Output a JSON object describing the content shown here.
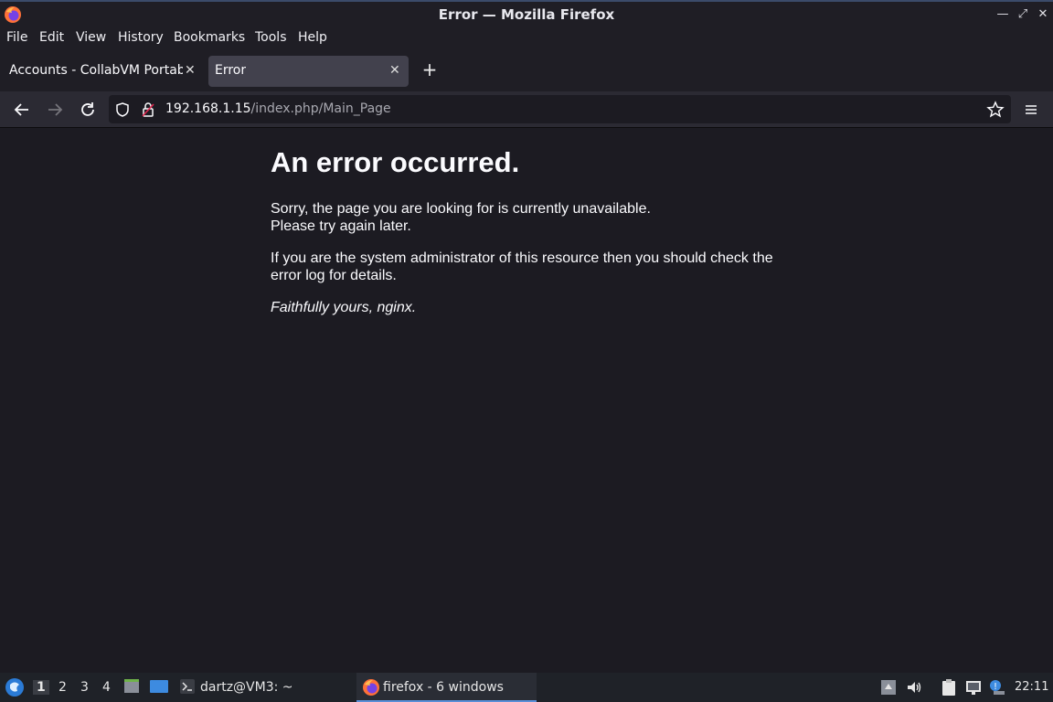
{
  "window": {
    "title": "Error — Mozilla Firefox"
  },
  "menu": [
    "File",
    "Edit",
    "View",
    "History",
    "Bookmarks",
    "Tools",
    "Help"
  ],
  "tabs": [
    {
      "label": "Accounts - CollabVM Portable",
      "active": false
    },
    {
      "label": "Error",
      "active": true
    }
  ],
  "urlbar": {
    "host": "192.168.1.15",
    "path": "/index.php/Main_Page"
  },
  "page": {
    "heading": "An error occurred.",
    "line1": "Sorry, the page you are looking for is currently unavailable.",
    "line2": "Please try again later.",
    "admin_line1": "If you are the system administrator of this resource then you should check the",
    "admin_line2": "error log for details.",
    "signature": "Faithfully yours, nginx."
  },
  "taskbar": {
    "workspaces": [
      "1",
      "2",
      "3",
      "4"
    ],
    "terminal_task": "dartz@VM3: ~",
    "firefox_task": "firefox - 6 windows",
    "clock": "22:11"
  },
  "colors": {
    "accent": "#5a8fd8",
    "background": "#1c1b22"
  },
  "icons": [
    "firefox-icon",
    "minimize-icon",
    "maximize-icon",
    "close-icon",
    "back-icon",
    "forward-icon",
    "reload-icon",
    "shield-icon",
    "lock-icon",
    "star-icon",
    "menu-icon",
    "plus-icon",
    "start-menu-icon",
    "file-manager-icon",
    "desktop-icon",
    "terminal-icon",
    "volume-icon",
    "clipboard-icon",
    "network-icon",
    "notification-icon"
  ]
}
